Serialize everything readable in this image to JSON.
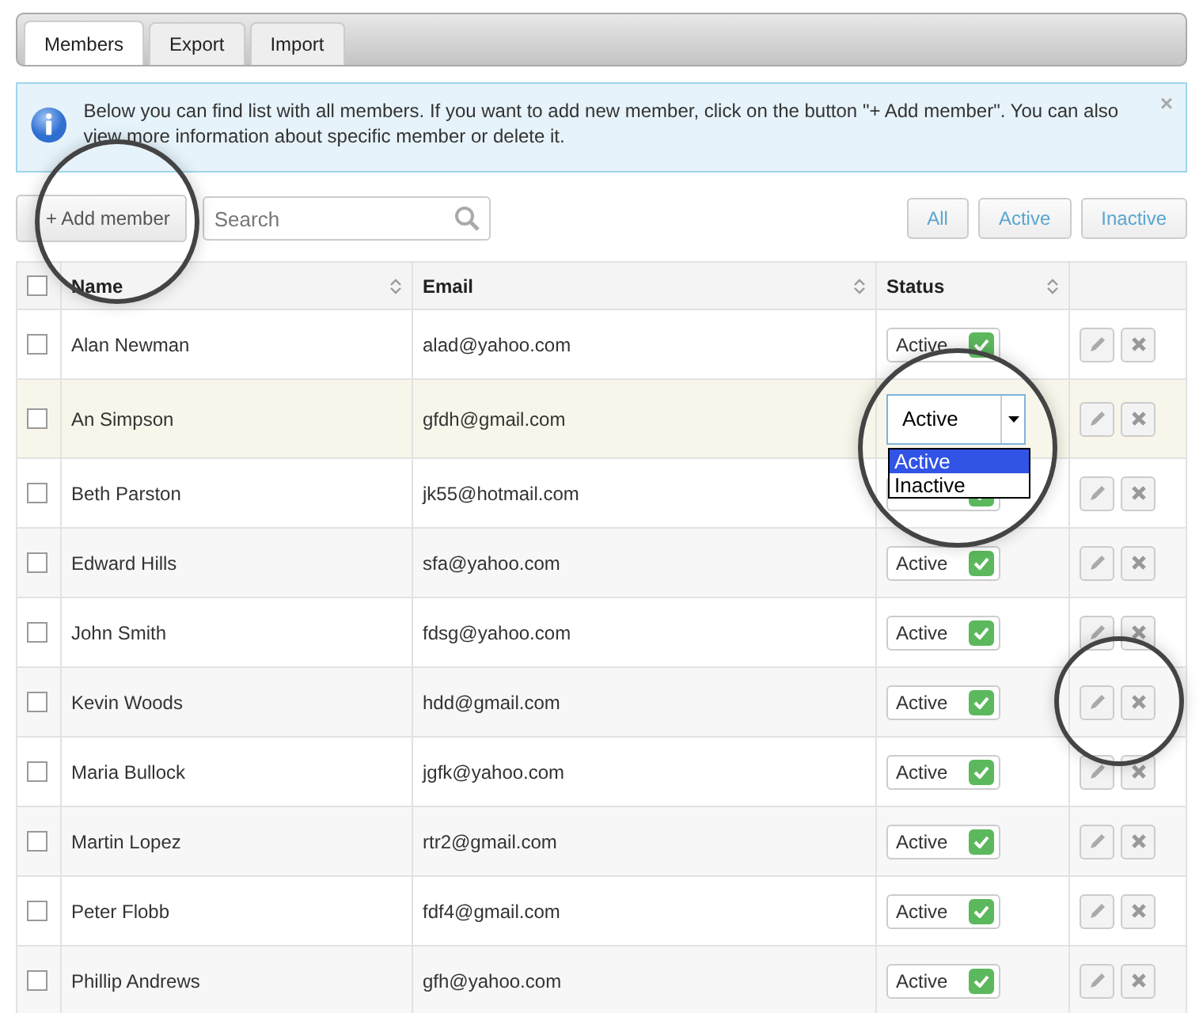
{
  "tabs": [
    {
      "label": "Members",
      "selected": true
    },
    {
      "label": "Export",
      "selected": false
    },
    {
      "label": "Import",
      "selected": false
    }
  ],
  "info": {
    "text": "Below you can find list with all members. If you want to add new member, click on the button \"+ Add member\". You can also view more information about specific member or delete it.",
    "close": "×"
  },
  "toolbar": {
    "add_button": "+ Add member",
    "search": {
      "placeholder": "Search"
    },
    "filters": [
      {
        "label": "All",
        "selected": false
      },
      {
        "label": "Active",
        "selected": false
      },
      {
        "label": "Inactive",
        "selected": false
      }
    ]
  },
  "table": {
    "columns": [
      {
        "label": "Name",
        "sortable": true
      },
      {
        "label": "Email",
        "sortable": true
      },
      {
        "label": "Status",
        "sortable": true
      }
    ],
    "header_checked": false,
    "rows": [
      {
        "name": "Alan Newman",
        "email": "alad@yahoo.com",
        "checked": false,
        "highlighted": false,
        "status": {
          "kind": "badge",
          "label": "Active",
          "checked": true
        }
      },
      {
        "name": "An Simpson",
        "email": "gfdh@gmail.com",
        "checked": false,
        "highlighted": true,
        "status": {
          "kind": "dropdown",
          "value": "Active",
          "options": [
            {
              "label": "Active",
              "selected": true
            },
            {
              "label": "Inactive",
              "selected": false
            }
          ]
        }
      },
      {
        "name": "Beth Parston",
        "email": "jk55@hotmail.com",
        "checked": false,
        "highlighted": false,
        "status": {
          "kind": "covered",
          "checked": true
        }
      },
      {
        "name": "Edward Hills",
        "email": "sfa@yahoo.com",
        "checked": false,
        "highlighted": false,
        "status": {
          "kind": "badge",
          "label": "Active",
          "checked": true
        }
      },
      {
        "name": "John Smith",
        "email": "fdsg@yahoo.com",
        "checked": false,
        "highlighted": false,
        "status": {
          "kind": "badge",
          "label": "Active",
          "checked": true
        }
      },
      {
        "name": "Kevin Woods",
        "email": "hdd@gmail.com",
        "checked": false,
        "highlighted": false,
        "status": {
          "kind": "badge",
          "label": "Active",
          "checked": true
        }
      },
      {
        "name": "Maria Bullock",
        "email": "jgfk@yahoo.com",
        "checked": false,
        "highlighted": false,
        "status": {
          "kind": "badge",
          "label": "Active",
          "checked": true
        }
      },
      {
        "name": "Martin Lopez",
        "email": "rtr2@gmail.com",
        "checked": false,
        "highlighted": false,
        "status": {
          "kind": "badge",
          "label": "Active",
          "checked": true
        }
      },
      {
        "name": "Peter Flobb",
        "email": "fdf4@gmail.com",
        "checked": false,
        "highlighted": false,
        "status": {
          "kind": "badge",
          "label": "Active",
          "checked": true
        }
      },
      {
        "name": "Phillip Andrews",
        "email": "gfh@yahoo.com",
        "checked": false,
        "highlighted": false,
        "status": {
          "kind": "badge",
          "label": "Active",
          "checked": true
        }
      }
    ]
  }
}
